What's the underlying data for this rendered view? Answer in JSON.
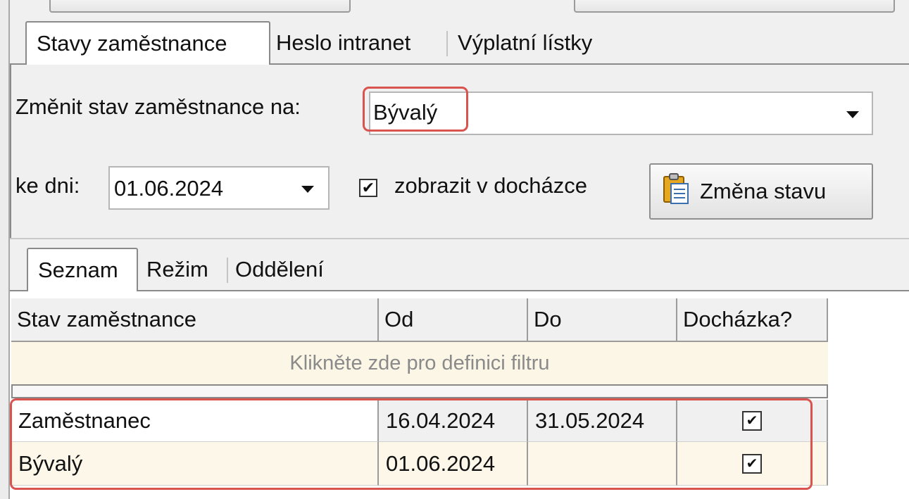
{
  "tabs": [
    {
      "label": "Stavy zaměstnance",
      "active": true
    },
    {
      "label": "Heslo intranet",
      "active": false
    },
    {
      "label": "Výplatní lístky",
      "active": false
    }
  ],
  "form": {
    "change_state_label": "Změnit stav zaměstnance na:",
    "state_value": "Bývalý",
    "date_label": "ke dni:",
    "date_value": "01.06.2024",
    "show_attendance_label": "zobrazit v docházce",
    "show_attendance_checked": true,
    "change_button_label": "Změna stavu"
  },
  "inner_tabs": [
    {
      "label": "Seznam",
      "active": true
    },
    {
      "label": "Režim",
      "active": false
    },
    {
      "label": "Oddělení",
      "active": false
    }
  ],
  "grid": {
    "columns": [
      "Stav zaměstnance",
      "Od",
      "Do",
      "Docházka?"
    ],
    "filter_hint": "Klikněte zde pro definici filtru",
    "rows": [
      {
        "state": "Zaměstnanec",
        "from": "16.04.2024",
        "to": "31.05.2024",
        "attendance": true
      },
      {
        "state": "Bývalý",
        "from": "01.06.2024",
        "to": "",
        "attendance": true
      }
    ]
  },
  "icons": {
    "combo_arrow": "chevron-down-icon",
    "change_button": "clipboard-icon"
  },
  "colors": {
    "highlight": "#d9534f",
    "filter_row_bg": "#fcf6e6",
    "alt_row_bg": "#fdf7ea",
    "panel_bg": "#f0f0f0"
  }
}
